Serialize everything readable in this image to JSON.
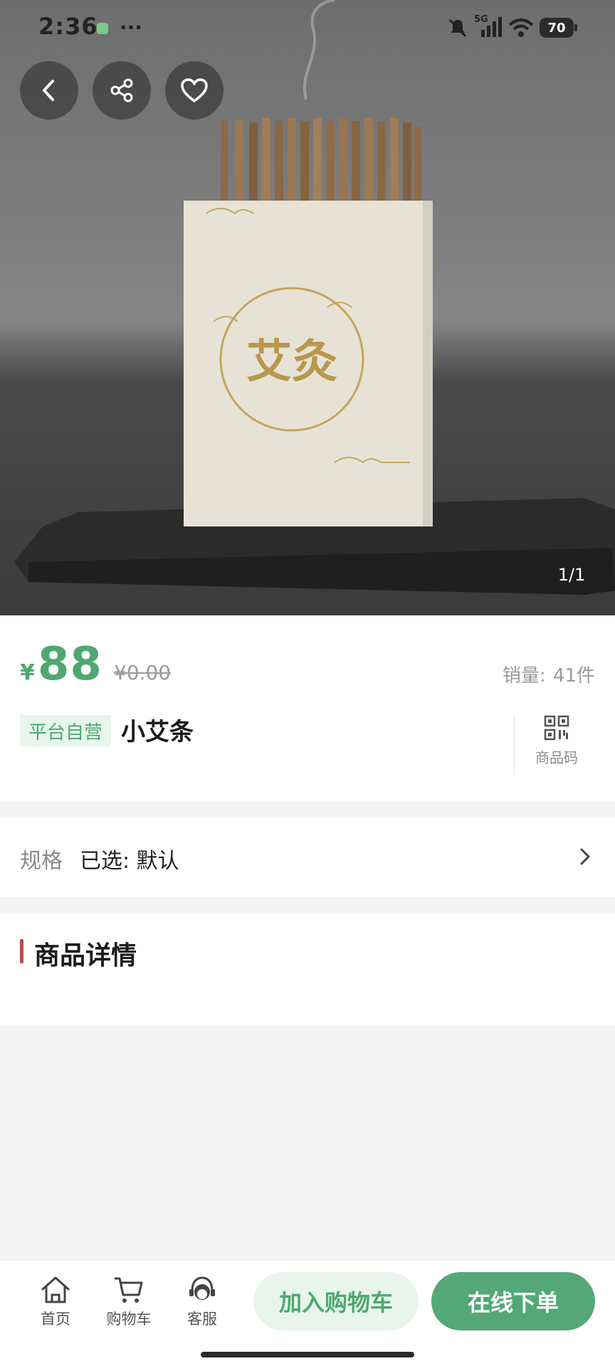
{
  "status_bar": {
    "time": "2:36",
    "more": "···",
    "network": "5G",
    "battery": "70"
  },
  "hero": {
    "image_label": "艾灸",
    "pager": "1/1",
    "buttons": [
      "back-icon",
      "share-icon",
      "heart-icon"
    ]
  },
  "product": {
    "currency": "¥",
    "price": "88",
    "original_price": "¥0.00",
    "sales_label": "销量:",
    "sales_value": "41件",
    "tag": "平台自营",
    "name": "小艾条",
    "code_label": "商品码"
  },
  "spec": {
    "label": "规格",
    "value": "已选: 默认"
  },
  "details": {
    "title": "商品详情"
  },
  "bottom_nav": {
    "items": [
      {
        "label": "首页",
        "icon": "home-icon"
      },
      {
        "label": "购物车",
        "icon": "cart-icon"
      },
      {
        "label": "客服",
        "icon": "customer-service-icon"
      }
    ],
    "add_to_cart": "加入购物车",
    "buy_now": "在线下单"
  },
  "colors": {
    "accent": "#54a877",
    "accent_text": "#4fa86f",
    "tag_bg": "#e8f5ec",
    "title_bar": "#b84a4a"
  }
}
